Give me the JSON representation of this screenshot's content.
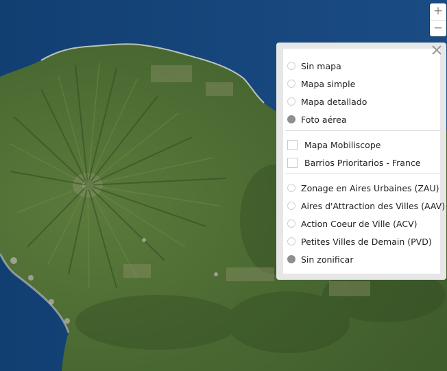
{
  "map": {
    "type": "satellite imagery",
    "colors": {
      "ocean": "#16467a",
      "ocean_deep": "#0f3768",
      "land": "#4f6e35",
      "land_dark": "#3a5527",
      "land_light": "#6f8b4c"
    }
  },
  "zoom": {
    "in_label": "+",
    "out_label": "−"
  },
  "layers_panel": {
    "close_icon": "close-icon",
    "basemaps": [
      {
        "label": "Sin mapa",
        "checked": false
      },
      {
        "label": "Mapa simple",
        "checked": false
      },
      {
        "label": "Mapa detallado",
        "checked": false
      },
      {
        "label": "Foto aérea",
        "checked": true
      }
    ],
    "overlays": [
      {
        "label": "Mapa Mobiliscope",
        "checked": false
      },
      {
        "label": "Barrios Prioritarios - France",
        "checked": false
      }
    ],
    "zonings": [
      {
        "label": "Zonage en Aires Urbaines (ZAU)",
        "checked": false
      },
      {
        "label": "Aires d'Attraction des Villes (AAV)",
        "checked": false
      },
      {
        "label": "Action Coeur de Ville (ACV)",
        "checked": false
      },
      {
        "label": "Petites Villes de Demain (PVD)",
        "checked": false
      },
      {
        "label": "Sin zonificar",
        "checked": true
      }
    ]
  }
}
